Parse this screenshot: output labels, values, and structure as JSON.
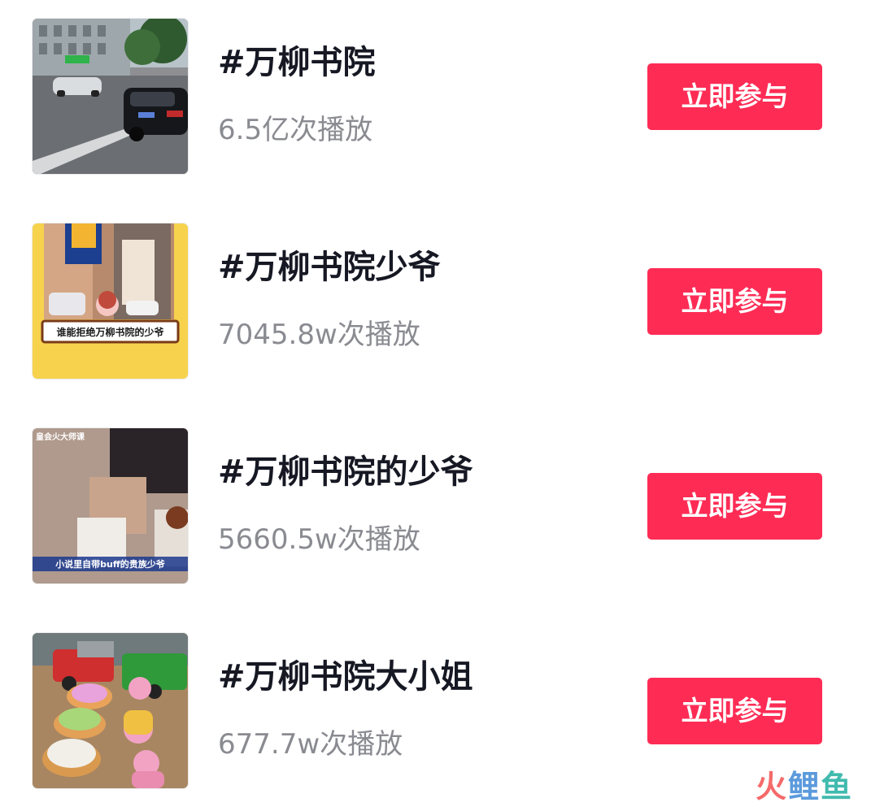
{
  "topics": [
    {
      "title": "#万柳书院",
      "plays": "6.5亿次播放",
      "button": "立即参与"
    },
    {
      "title": "#万柳书院少爷",
      "plays": "7045.8w次播放",
      "button": "立即参与",
      "thumb_caption": "谁能拒绝万柳书院的少爷"
    },
    {
      "title": "#万柳书院的少爷",
      "plays": "5660.5w次播放",
      "button": "立即参与",
      "thumb_caption": "小说里自带buff的贵族少爷",
      "thumb_corner_text": "皇会火大师课"
    },
    {
      "title": "#万柳书院大小姐",
      "plays": "677.7w次播放",
      "button": "立即参与"
    }
  ],
  "watermark": {
    "part1": "火",
    "part2": "鲤",
    "part3": "鱼"
  },
  "colors": {
    "button_bg": "#fe2c55",
    "title": "#161823",
    "plays": "#8a8b91"
  }
}
